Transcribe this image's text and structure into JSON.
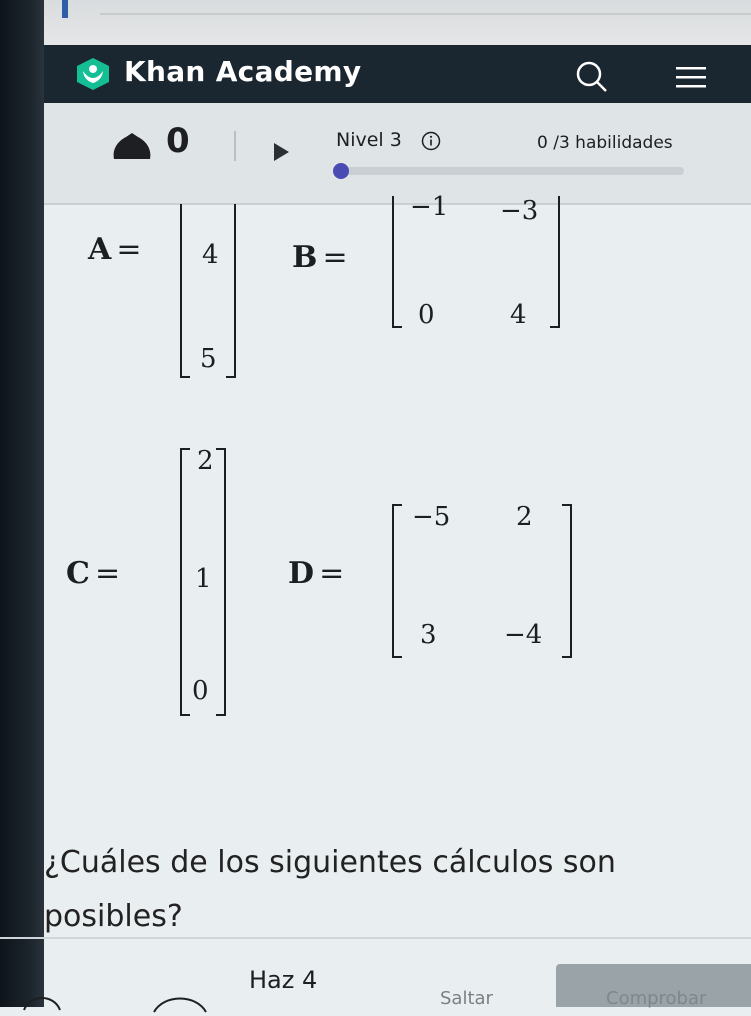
{
  "header": {
    "brand": "Khan Academy",
    "icons": [
      "khan-leaf-icon",
      "search-icon",
      "hamburger-menu-icon"
    ]
  },
  "progress": {
    "points": "0",
    "level": "Nivel 3",
    "skills": "0 /3 habilidades",
    "energy_color": "#1d1f22",
    "accent": "#4a4ab5"
  },
  "matrices": {
    "A": {
      "label": "A",
      "rows": [
        [
          "4"
        ],
        [
          "5"
        ]
      ]
    },
    "B": {
      "label": "B",
      "rows": [
        [
          "−1",
          "−3"
        ],
        [
          "0",
          "4"
        ]
      ]
    },
    "C": {
      "label": "C",
      "rows": [
        [
          "2"
        ],
        [
          "1"
        ],
        [
          "0"
        ]
      ]
    },
    "D": {
      "label": "D",
      "rows": [
        [
          "−5",
          "2"
        ],
        [
          "3",
          "−4"
        ]
      ]
    },
    "equals": "="
  },
  "question": "¿Cuáles de los siguientes cálculos son posibles?",
  "footer": {
    "task_label": "Haz 4",
    "skip_label": "Saltar",
    "check_label": "Comprobar"
  },
  "colors": {
    "header_bg": "#1a2630",
    "page_bg": "#e9eef0",
    "logo_green": "#14bf96"
  }
}
